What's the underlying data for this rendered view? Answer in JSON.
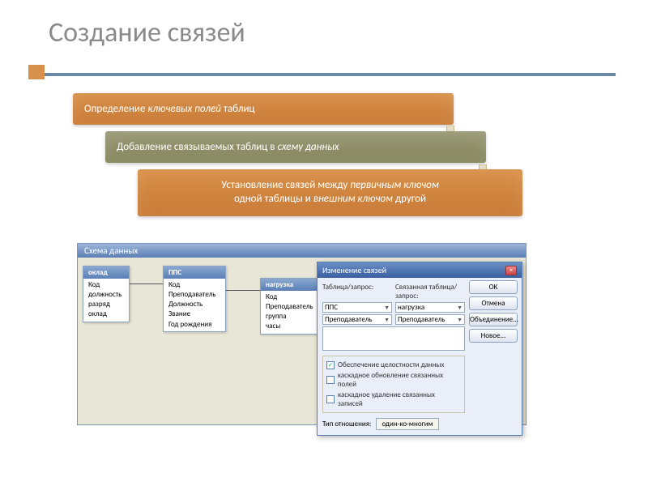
{
  "title": "Создание связей",
  "steps": {
    "s1": "Определение <em>ключевых полей</em> таблиц",
    "s2": "Добавление связываемых таблиц в <em>схему данных</em>",
    "s3": "Установление связей между <em>первичным ключом</em><br>одной таблицы и <em>внешним ключом</em> другой"
  },
  "schema": {
    "window_title": "Схема данных",
    "tables": {
      "t1": {
        "name": "оклад",
        "fields": [
          "Код",
          "должность",
          "разряд",
          "оклад"
        ]
      },
      "t2": {
        "name": "ППС",
        "fields": [
          "Код",
          "Преподаватель",
          "Должность",
          "Звание",
          "Год рождения"
        ]
      },
      "t3": {
        "name": "нагрузка",
        "fields": [
          "Код",
          "Преподаватель",
          "группа",
          "часы"
        ]
      }
    }
  },
  "dialog": {
    "title": "Изменение связей",
    "label_left": "Таблица/запрос:",
    "label_right": "Связанная таблица/запрос:",
    "combo1_left": "ППС",
    "combo1_right": "нагрузка",
    "combo2_left": "Преподаватель",
    "combo2_right": "Преподаватель",
    "chk1": "Обеспечение целостности данных",
    "chk2": "каскадное обновление связанных полей",
    "chk3": "каскадное удаление связанных записей",
    "type_label": "Тип отношения:",
    "type_value": "один-ко-многим",
    "btn_ok": "OK",
    "btn_cancel": "Отмена",
    "btn_join": "Объединение...",
    "btn_new": "Новое..."
  }
}
